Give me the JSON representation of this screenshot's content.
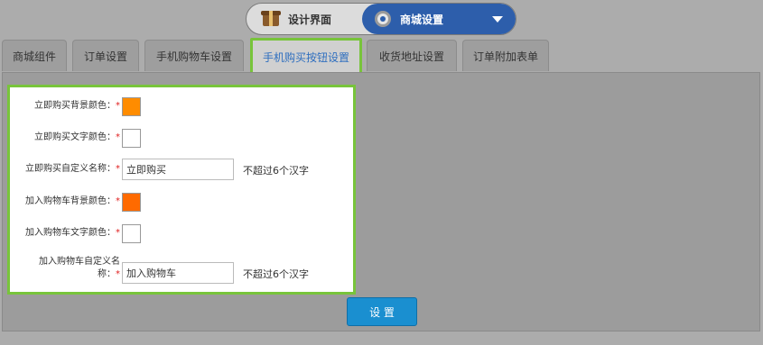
{
  "mode_switch": {
    "left_label": "设计界面",
    "right_label": "商城设置",
    "left_icon": "toolbox-icon",
    "right_icon": "gear-icon",
    "accent": "#2d5eab"
  },
  "tabs": [
    {
      "label": "商城组件",
      "active": false
    },
    {
      "label": "订单设置",
      "active": false
    },
    {
      "label": "手机购物车设置",
      "active": false
    },
    {
      "label": "手机购买按钮设置",
      "active": true
    },
    {
      "label": "收货地址设置",
      "active": false
    },
    {
      "label": "订单附加表单",
      "active": false
    }
  ],
  "form": {
    "required_mark": "*",
    "buy_bg_color": {
      "label": "立即购买背景颜色：",
      "color": "#ff8c00"
    },
    "buy_text_color": {
      "label": "立即购买文字颜色：",
      "color": "#ffffff"
    },
    "buy_name": {
      "label": "立即购买自定义名称：",
      "value": "立即购买",
      "hint": "不超过6个汉字"
    },
    "cart_bg_color": {
      "label": "加入购物车背景颜色：",
      "color": "#ff6a00"
    },
    "cart_text_color": {
      "label": "加入购物车文字颜色：",
      "color": "#ffffff"
    },
    "cart_name": {
      "label_line1": "加入购物车自定义名",
      "label_line2": "称：",
      "value": "加入购物车",
      "hint": "不超过6个汉字"
    }
  },
  "submit_label": "设 置",
  "highlight_color": "#78c43b"
}
